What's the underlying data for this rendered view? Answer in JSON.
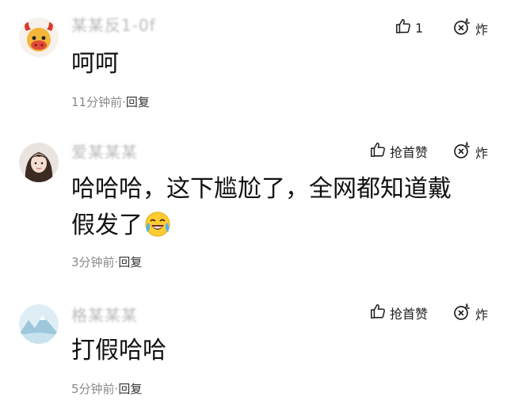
{
  "comments": [
    {
      "username": "某某反1-0f",
      "like_icon": "thumbs-up-icon",
      "like_label": "1",
      "bomb_icon": "bomb-icon",
      "bomb_label": "炸",
      "text": "呵呵",
      "time": "11分钟前",
      "separator": "·",
      "reply": "回复"
    },
    {
      "username": "爱某某某",
      "like_icon": "thumbs-up-icon",
      "like_label": "抢首赞",
      "bomb_icon": "bomb-icon",
      "bomb_label": "炸",
      "text_line1": "哈哈哈，这下尴尬了，全网都知道戴",
      "text_line2": "假发了",
      "emoji": "laughing-crying-emoji",
      "time": "3分钟前",
      "separator": "·",
      "reply": "回复"
    },
    {
      "username": "格某某某",
      "like_icon": "thumbs-up-icon",
      "like_label": "抢首赞",
      "bomb_icon": "bomb-icon",
      "bomb_label": "炸",
      "text": "打假哈哈",
      "time": "5分钟前",
      "separator": "·",
      "reply": "回复"
    }
  ],
  "colors": {
    "meta": "#8a8a8a",
    "text": "#111111",
    "icon": "#222222"
  }
}
